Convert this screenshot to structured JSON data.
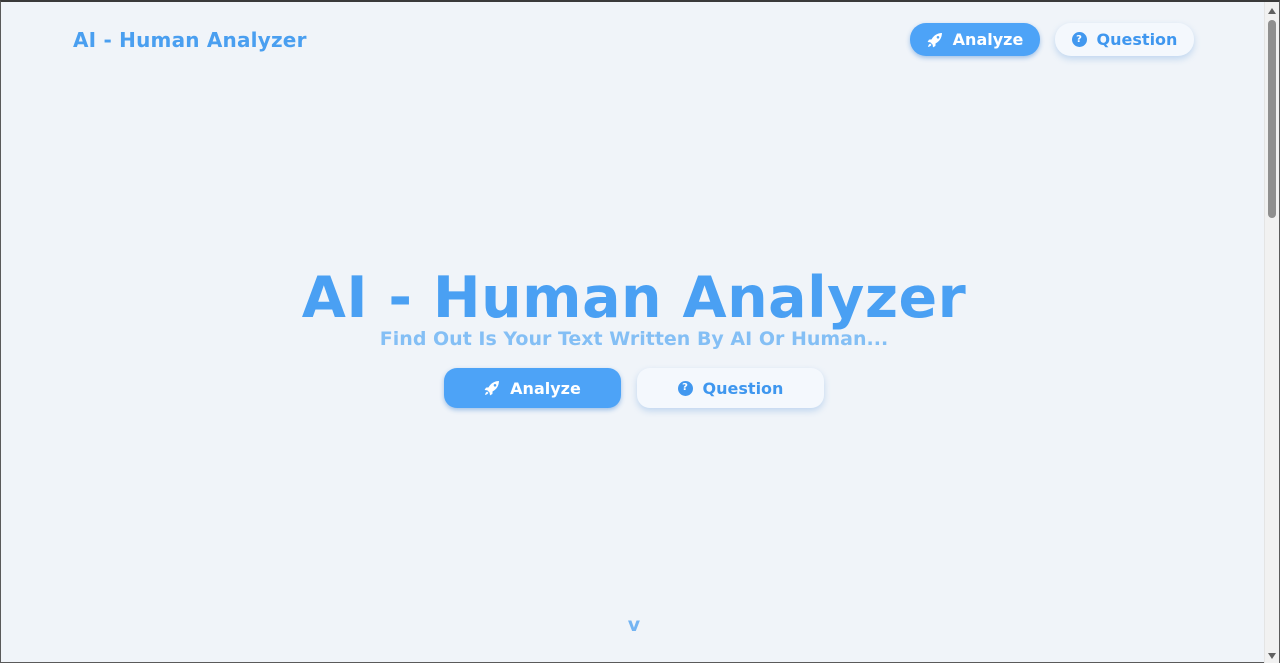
{
  "nav": {
    "brand": "AI - Human Analyzer",
    "analyze_label": "Analyze",
    "question_label": "Question"
  },
  "hero": {
    "title": "AI - Human Analyzer",
    "subtitle": "Find Out Is Your Text Written By AI Or Human...",
    "analyze_label": "Analyze",
    "question_label": "Question"
  },
  "scroll_hint": "v",
  "icons": {
    "analyze": "rocket-icon",
    "question": "question-circle-icon",
    "question_glyph": "?"
  },
  "colors": {
    "background": "#f0f4f9",
    "accent": "#4aa0f3",
    "subtitle": "#84bff5",
    "button_primary": "#4da3f7"
  }
}
